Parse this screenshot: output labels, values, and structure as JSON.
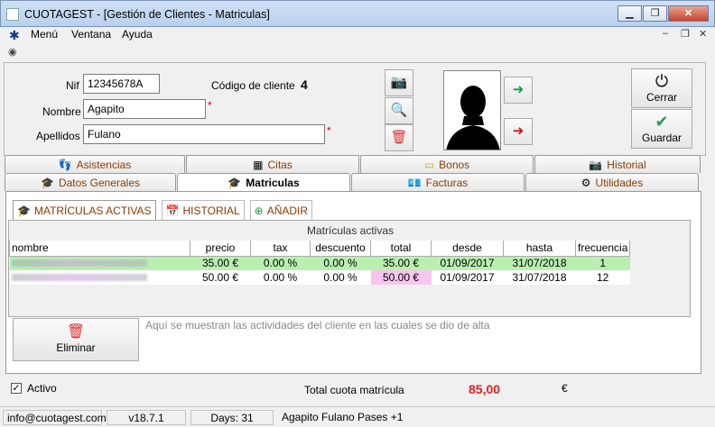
{
  "window": {
    "title": "CUOTAGEST - [Gestión de Clientes - Matriculas]"
  },
  "menu": [
    "Menú",
    "Ventana",
    "Ayuda"
  ],
  "client": {
    "nif_label": "Nif",
    "nif_value": "12345678A",
    "nombre_label": "Nombre",
    "nombre_value": "Agapito",
    "apellidos_label": "Apellidos",
    "apellidos_value": "Fulano",
    "required_mark": "*",
    "code_label": "Código de cliente",
    "code_value": "4"
  },
  "actions": {
    "close": "Cerrar",
    "save": "Guardar"
  },
  "tabs_top": [
    {
      "label": "Asistencias",
      "icon": "footprints-icon"
    },
    {
      "label": "Citas",
      "icon": "calendar-grid-icon"
    },
    {
      "label": "Bonos",
      "icon": "ticket-icon"
    },
    {
      "label": "Historial",
      "icon": "camera-icon"
    }
  ],
  "tabs_bottom": [
    {
      "label": "Datos Generales",
      "icon": "graduation-cap-icon"
    },
    {
      "label": "Matriculas",
      "icon": "graduation-cap-icon",
      "active": true
    },
    {
      "label": "Facturas",
      "icon": "money-icon"
    },
    {
      "label": "Utilidades",
      "icon": "gear-icon"
    }
  ],
  "subtabs": [
    {
      "label": "MATRÍCULAS ACTIVAS",
      "icon": "graduation-cap-icon",
      "active": true
    },
    {
      "label": "HISTORIAL",
      "icon": "calendar-icon"
    },
    {
      "label": "AÑADIR",
      "icon": "plus-circle-icon"
    }
  ],
  "grid": {
    "caption": "Matrículas activas",
    "columns": [
      "nombre",
      "precio",
      "tax",
      "descuento",
      "total",
      "desde",
      "hasta",
      "frecuencia"
    ],
    "rows": [
      [
        "",
        "35.00 €",
        "0.00 %",
        "0.00 %",
        "35.00 €",
        "01/09/2017",
        "31/07/2018",
        "1"
      ],
      [
        "",
        "50.00 €",
        "0.00 %",
        "0.00 %",
        "50.00 €",
        "01/09/2017",
        "31/07/2018",
        "12"
      ]
    ]
  },
  "delete_button": "Eliminar",
  "hint": "Aquí se muestran las actividades del cliente en las cuales se dio de alta",
  "footer": {
    "activo": "Activo",
    "total_label": "Total cuota matrícula",
    "total_value": "85,00",
    "currency": "€"
  },
  "statusbar": {
    "email": "info@cuotagest.com",
    "version": "v18.7.1",
    "days": "Days: 31",
    "user": "Agapito Fulano Pases +1"
  },
  "colors": {
    "row_active": "#b9f0b0",
    "row_highlight": "#f7c6ee",
    "total_red": "#e02020",
    "subtab_text": "#8a3a00"
  }
}
